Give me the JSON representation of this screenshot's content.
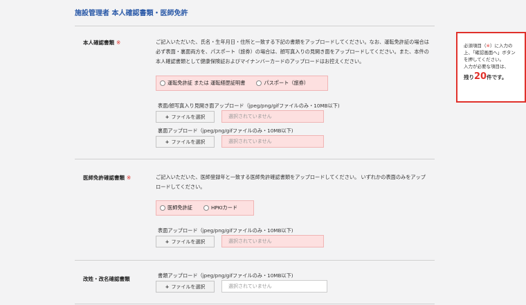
{
  "page_title": "施設管理者 本人確認書類・医師免許",
  "required_mark": "※",
  "notice": {
    "line1_pre": "必須項目（",
    "line1_mark": "※",
    "line1_post": "）に入力の",
    "line2": "上、「確認画面へ」ボタン",
    "line3": "を押してください。",
    "line4": "入力が必要な項目は、",
    "remaining_pre": "残り",
    "remaining_count": "20",
    "remaining_post": "件です。"
  },
  "identity": {
    "label": "本人確認書類",
    "desc": "ご記入いただいた、氏名・生年月日・住所と一致する下記の書類をアップロードしてください。なお、運転免許証の場合は必ず表面・裏面両方を、パスポート（旅券）の場合は、顔写真入りの見開き面をアップロードしてください。また、本件の本人確認書類として健康保険証およびマイナンバーカードのアップロードはお控えください。",
    "options": [
      "運転免許証 または 運転経歴証明書",
      "パスポート（旅券）"
    ],
    "upload_front_label": "表面/顔写真入り見開き面アップロード（jpeg/png/gifファイルのみ・10MB以下)",
    "upload_back_label": "裏面アップロード（jpeg/png/gifファイルのみ・10MB以下)"
  },
  "license": {
    "label": "医師免許確認書類",
    "desc": "ご記入いただいた、医師登録年と一致する医師免許確認書類をアップロードしてください。 いずれかの表面のみをアップロードしてください。",
    "options": [
      "医師免許証",
      "HPKIカード"
    ],
    "upload_front_label": "表面アップロード（jpeg/png/gifファイルのみ・10MB以下)"
  },
  "rename": {
    "label": "改姓・改名確認書類",
    "upload_label": "書類アップロード（jpeg/png/gifファイルのみ・10MB以下)"
  },
  "file_button_plus": "+",
  "file_button_label": "ファイルを選択",
  "file_none_text": "選択されていません"
}
